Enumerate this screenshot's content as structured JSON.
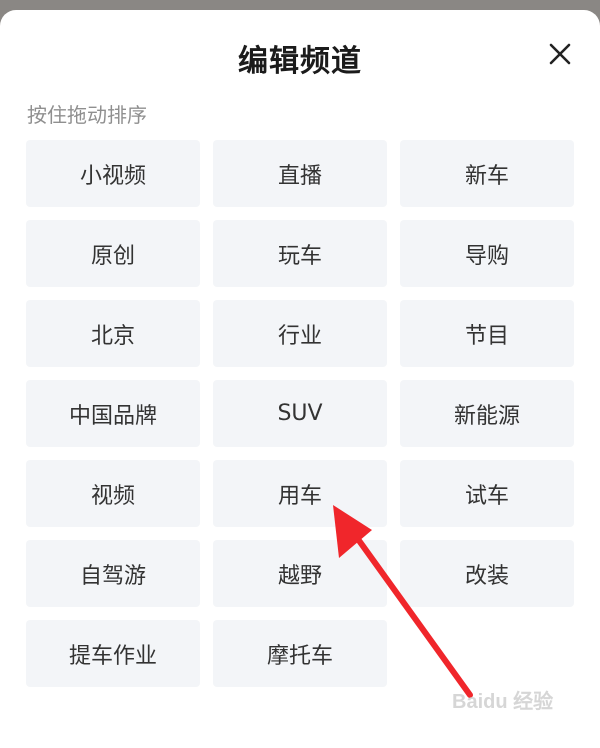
{
  "dialog": {
    "title": "编辑频道",
    "hint": "按住拖动排序",
    "close_icon": "close-icon"
  },
  "channels": [
    {
      "label": "小视频"
    },
    {
      "label": "直播"
    },
    {
      "label": "新车"
    },
    {
      "label": "原创"
    },
    {
      "label": "玩车"
    },
    {
      "label": "导购"
    },
    {
      "label": "北京"
    },
    {
      "label": "行业"
    },
    {
      "label": "节目"
    },
    {
      "label": "中国品牌"
    },
    {
      "label": "SUV"
    },
    {
      "label": "新能源"
    },
    {
      "label": "视频"
    },
    {
      "label": "用车"
    },
    {
      "label": "试车"
    },
    {
      "label": "自驾游"
    },
    {
      "label": "越野"
    },
    {
      "label": "改装"
    },
    {
      "label": "提车作业"
    },
    {
      "label": "摩托车"
    }
  ],
  "annotation": {
    "color": "#f0262b"
  },
  "watermark": {
    "text": "Baidu 经验"
  }
}
